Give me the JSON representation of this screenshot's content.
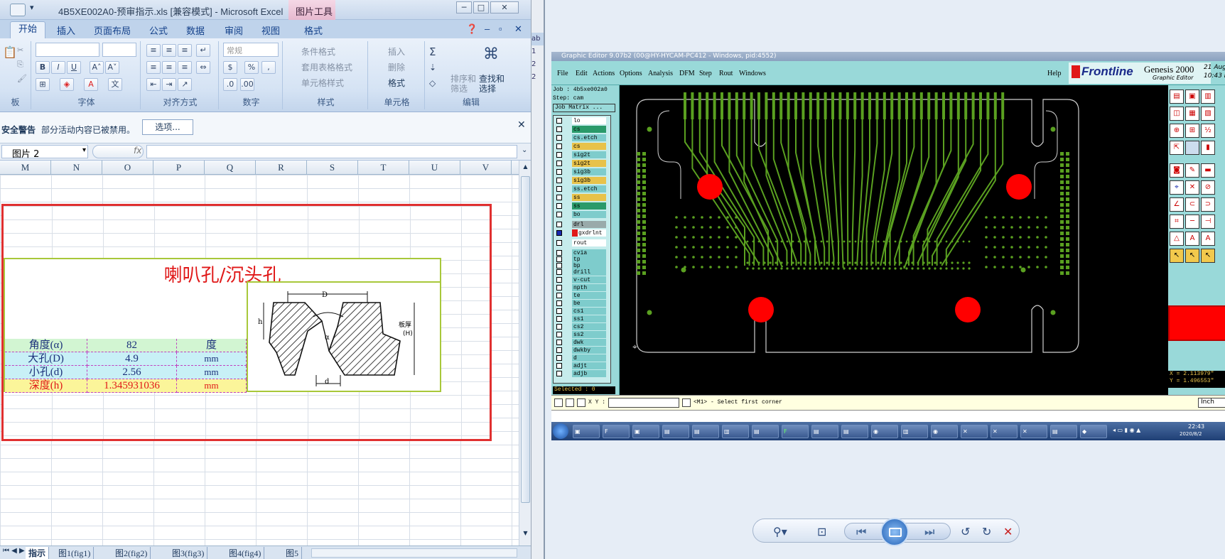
{
  "excel": {
    "title": "4B5XE002A0-预审指示.xls  [兼容模式] - Microsoft Excel",
    "picture_tools": "图片工具",
    "tabs": [
      "开始",
      "插入",
      "页面布局",
      "公式",
      "数据",
      "审阅",
      "视图",
      "格式"
    ],
    "groups": {
      "clip": "板",
      "font": "字体",
      "align": "对齐方式",
      "number": "数字",
      "styles": "样式",
      "cells": "单元格",
      "edit": "编辑"
    },
    "number_format": "常规",
    "styles": [
      "条件格式",
      "套用表格格式",
      "单元格样式"
    ],
    "cells_btns": [
      "插入",
      "删除",
      "格式"
    ],
    "edit_btns": {
      "sort": "排序和\n筛选",
      "find": "查找和\n选择"
    },
    "security": {
      "label": "安全警告",
      "message": "部分活动内容已被禁用。",
      "button": "选项..."
    },
    "name_box": "图片 2",
    "fx": "fx",
    "columns": [
      "M",
      "N",
      "O",
      "P",
      "Q",
      "R",
      "S",
      "T",
      "U",
      "V"
    ],
    "sheet_tabs": [
      "指示",
      "图1(fig1)",
      "图2(fig2)",
      "图3(fig3)",
      "图4(fig4)",
      "图5"
    ],
    "picture": {
      "title": "喇叭孔/沉头孔",
      "rows": [
        {
          "name": "角度(α)",
          "value": "82",
          "unit": "度"
        },
        {
          "name": "大孔(D)",
          "value": "4.9",
          "unit": "mm"
        },
        {
          "name": "小孔(d)",
          "value": "2.56",
          "unit": "mm"
        },
        {
          "name": "深度(h)",
          "value": "1.345931036",
          "unit": "mm"
        }
      ],
      "diagram_labels": {
        "D": "D",
        "d": "d",
        "h": "h",
        "alpha": "α",
        "thickness": "板厚",
        "H": "(H)"
      }
    }
  },
  "genesis": {
    "title": "Graphic Editor 9.07b2 (00@HY-HYCAM-PC412 - Windows, pid:4552)",
    "menu": [
      "File",
      "Edit",
      "Actions",
      "Options",
      "Analysis",
      "DFM",
      "Step",
      "Rout",
      "Windows"
    ],
    "help": "Help",
    "brand": "Frontline",
    "product": "Genesis 2000",
    "sub": "Graphic Editor",
    "date": "21 Aug 2",
    "time": "10:43 P",
    "job": "Job : 4b5xe002a0",
    "step": "Step: cam",
    "matrix": "Job Matrix ...",
    "layers": [
      "lo",
      "cs",
      "cs.etch",
      "cs",
      "sig2t",
      "sig2t",
      "sig3b",
      "sig3b",
      "ss.etch",
      "ss",
      "ss",
      "bo",
      "drl",
      "gxdrlnt",
      "rout",
      "cvia",
      "tp",
      "bp",
      "drill",
      "v-cut",
      "npth",
      "te",
      "be",
      "cs1",
      "ss1",
      "cs2",
      "ss2",
      "dwk",
      "dwkby",
      "d",
      "adjt",
      "adjb"
    ],
    "selected": "Selected : 0",
    "xy_label": "X Y :",
    "prompt": "<M1> - Select first corner",
    "coord_x": "X = 2.113979\"",
    "coord_y": "Y = 1.496553\"",
    "units": "Inch",
    "clock": "22:43",
    "clock_date": "2020/8/2"
  },
  "colors": {
    "pad_red": "#ff0000",
    "trace_green": "#5aa020",
    "excel_red": "#e01818"
  }
}
